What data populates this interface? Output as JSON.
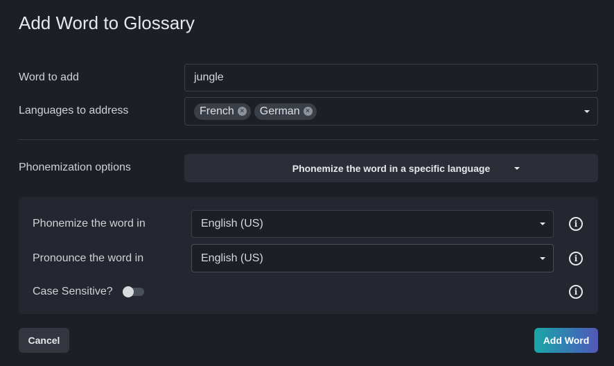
{
  "dialog": {
    "title": "Add Word to Glossary"
  },
  "word": {
    "label": "Word to add",
    "value": "jungle"
  },
  "languages": {
    "label": "Languages to address",
    "chips": [
      "French",
      "German"
    ]
  },
  "phonemization": {
    "label": "Phonemization options",
    "selected": "Phonemize the word in a specific language"
  },
  "panel": {
    "phonemize_in": {
      "label": "Phonemize the word in",
      "value": "English (US)"
    },
    "pronounce_in": {
      "label": "Pronounce the word in",
      "value": "English (US)"
    },
    "case_sensitive": {
      "label": "Case Sensitive?",
      "checked": false
    }
  },
  "footer": {
    "cancel_label": "Cancel",
    "add_label": "Add Word"
  },
  "colors": {
    "background": "#1c1f26",
    "panel": "#24272f",
    "accent_start": "#1aa7a6",
    "accent_end": "#5558b6"
  },
  "icons": {
    "info": "info-circle-icon",
    "chip_remove": "close-circle-icon",
    "dropdown": "caret-down-icon"
  }
}
